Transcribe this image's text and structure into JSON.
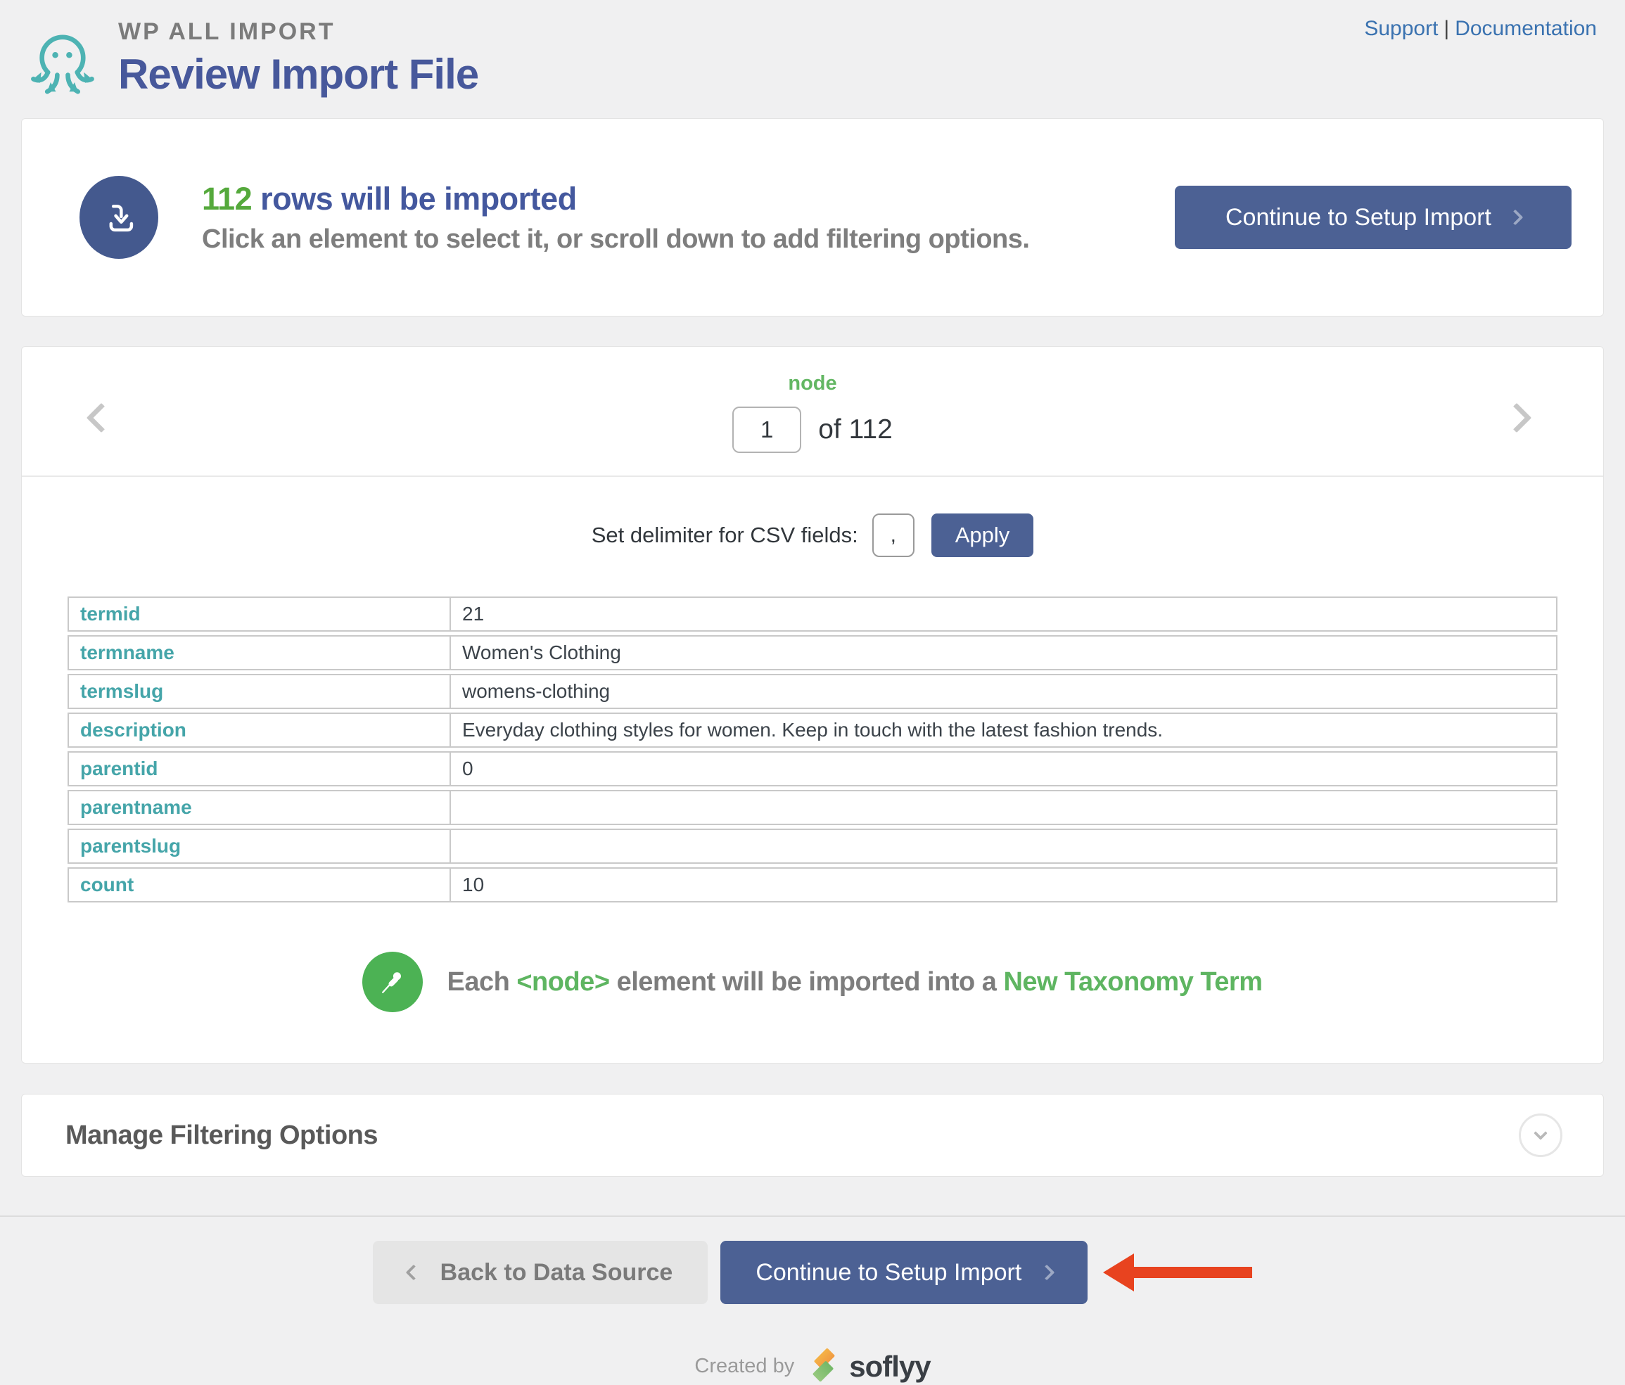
{
  "header": {
    "brand": "WP ALL IMPORT",
    "title": "Review Import File",
    "support_label": "Support",
    "links_divider": "|",
    "documentation_label": "Documentation"
  },
  "summary": {
    "count": "112",
    "headline_rest": " rows will be imported",
    "subtitle": "Click an element to select it, or scroll down to add filtering options.",
    "continue_button": "Continue to Setup Import"
  },
  "navigator": {
    "node_label": "node",
    "current_index": "1",
    "of_total": "of 112"
  },
  "delimiter": {
    "label": "Set delimiter for CSV fields:",
    "value": ",",
    "apply_button": "Apply"
  },
  "record_table": {
    "rows": [
      {
        "key": "termid",
        "value": "21"
      },
      {
        "key": "termname",
        "value": "Women's Clothing"
      },
      {
        "key": "termslug",
        "value": "womens-clothing"
      },
      {
        "key": "description",
        "value": "Everyday clothing styles for women. Keep in touch with the latest fashion trends."
      },
      {
        "key": "parentid",
        "value": "0"
      },
      {
        "key": "parentname",
        "value": ""
      },
      {
        "key": "parentslug",
        "value": ""
      },
      {
        "key": "count",
        "value": "10"
      }
    ]
  },
  "import_note": {
    "prefix": "Each ",
    "node_tag": "<node>",
    "middle": " element will be imported into a ",
    "target": "New Taxonomy Term"
  },
  "filtering": {
    "title": "Manage Filtering Options"
  },
  "footer_nav": {
    "back_button": "Back to Data Source",
    "continue_button": "Continue to Setup Import"
  },
  "footer": {
    "created_by": "Created by",
    "brand": "soflyy"
  },
  "colors": {
    "accent_blue": "#4c6194",
    "heading_blue": "#47589b",
    "accent_green": "#5eb561",
    "count_green": "#55a93c",
    "key_teal": "#45a5a9",
    "link_blue": "#3a72b0",
    "arrow_red": "#e8431f",
    "brand_teal": "#4db3b3"
  }
}
